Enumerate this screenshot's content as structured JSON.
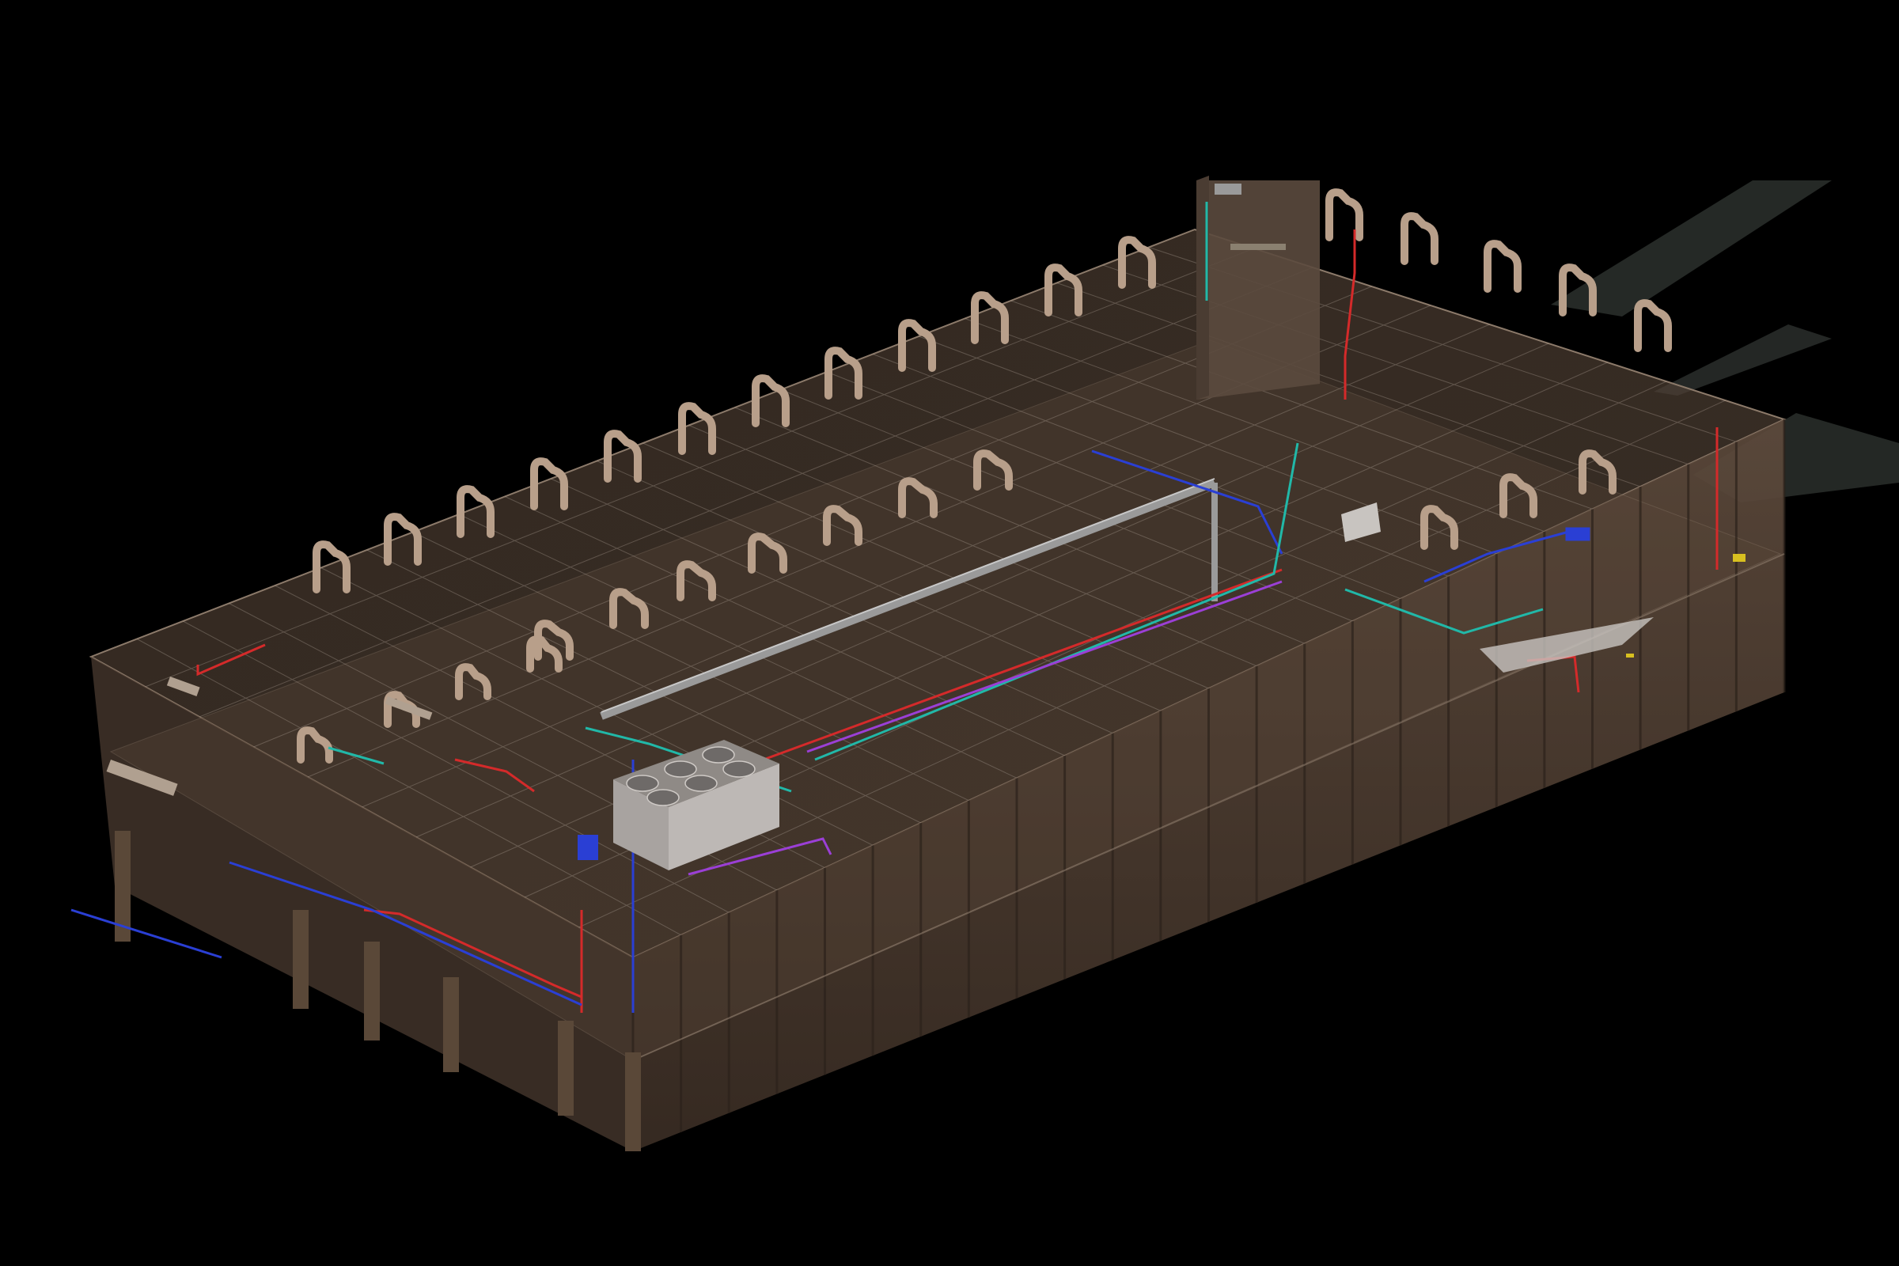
{
  "view": {
    "type": "3d-isometric-bim-model",
    "background_color": "#000000",
    "text_labels": []
  },
  "model": {
    "colors": {
      "structure_face": "#6a5646",
      "structure_dark": "#3e3128",
      "structure_edge": "#8c7a6a",
      "column": "#5a4838",
      "grid_line": "#b9aca0",
      "duct_loop": "#b89f8a",
      "supply_pipe": "#d42a2a",
      "return_pipe": "#2a3fd4",
      "chilled_pipe": "#21b8a8",
      "gas_pipe": "#9b3fd6",
      "main_duct": "#9a9a9a",
      "equipment": "#a8a3a0",
      "fan": "#6e6a68",
      "accent_yellow": "#d8c020",
      "lift_shaft": "#5b4a3e",
      "ramp": "#2a302c"
    },
    "layers": [
      "structure-slab",
      "structure-columns",
      "structure-beams",
      "duct-loops",
      "supply-pipes",
      "return-pipes",
      "chilled-water-pipes",
      "gas-pipes",
      "main-duct",
      "rooftop-equipment",
      "lift-shaft",
      "access-ramps"
    ]
  }
}
